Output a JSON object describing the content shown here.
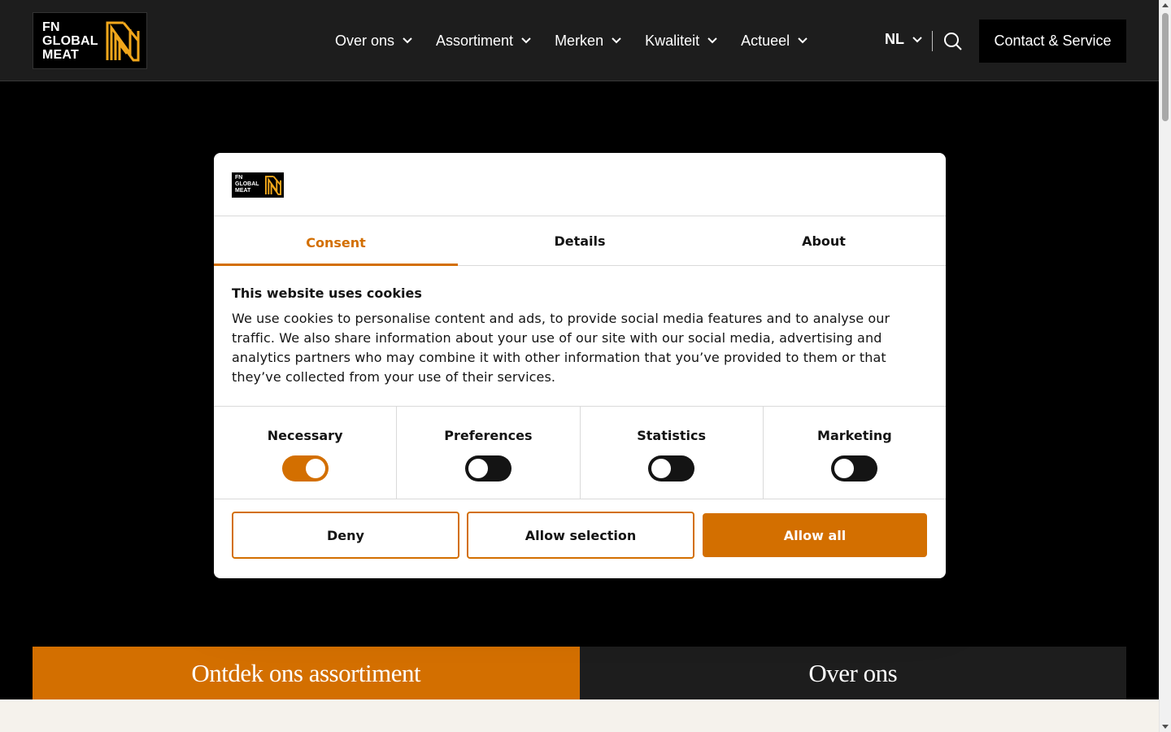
{
  "header": {
    "logo": {
      "line1": "FN",
      "line2": "GLOBAL",
      "line3": "MEAT"
    },
    "nav": [
      {
        "label": "Over ons"
      },
      {
        "label": "Assortiment"
      },
      {
        "label": "Merken"
      },
      {
        "label": "Kwaliteit"
      },
      {
        "label": "Actueel"
      }
    ],
    "language": "NL",
    "contact_label": "Contact & Service"
  },
  "cookie_dialog": {
    "logo": {
      "line1": "FN",
      "line2": "GLOBAL",
      "line3": "MEAT"
    },
    "tabs": [
      {
        "label": "Consent",
        "active": true
      },
      {
        "label": "Details",
        "active": false
      },
      {
        "label": "About",
        "active": false
      }
    ],
    "title": "This website uses cookies",
    "description": "We use cookies to personalise content and ads, to provide social media features and to analyse our traffic. We also share information about your use of our site with our social media, advertising and analytics partners who may combine it with other information that you’ve provided to them or that they’ve collected from your use of their services.",
    "categories": [
      {
        "label": "Necessary",
        "enabled": true
      },
      {
        "label": "Preferences",
        "enabled": false
      },
      {
        "label": "Statistics",
        "enabled": false
      },
      {
        "label": "Marketing",
        "enabled": false
      }
    ],
    "buttons": {
      "deny": "Deny",
      "allow_selection": "Allow selection",
      "allow_all": "Allow all"
    }
  },
  "ctas": {
    "assortment": "Ontdek ons assortiment",
    "about": "Over ons"
  },
  "colors": {
    "accent": "#d36f00",
    "header_bg": "#1d1d1d",
    "page_bg": "#000000",
    "logo_mark": "#f2a71b"
  }
}
